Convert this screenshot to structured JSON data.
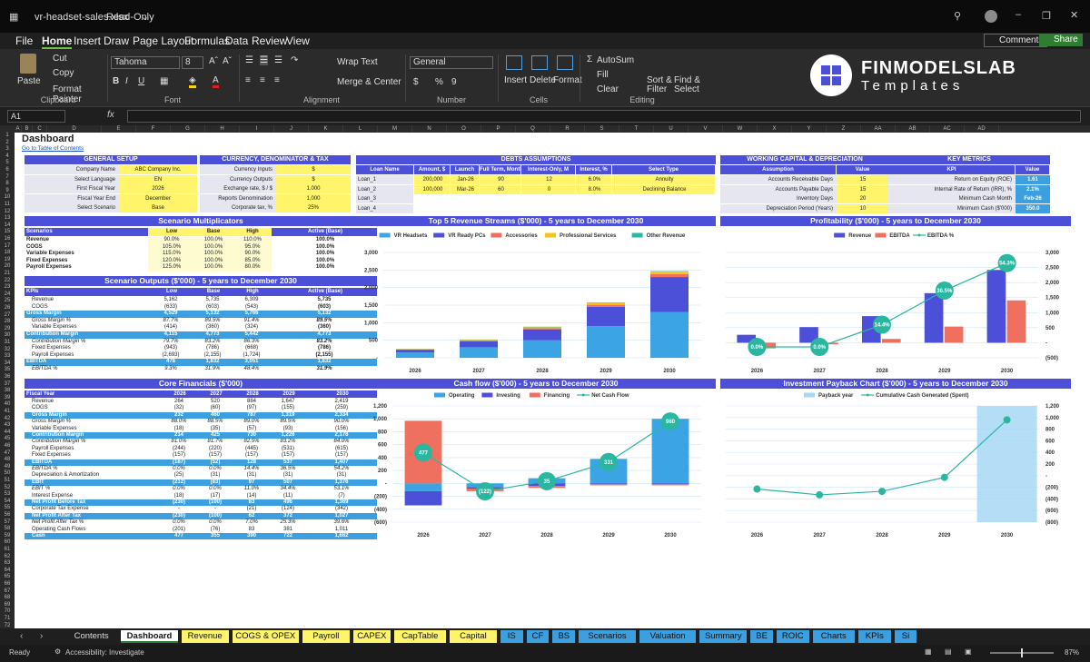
{
  "app": {
    "file": "vr-headset-sales.xlsx",
    "mode": "Read-Only"
  },
  "menu": [
    "File",
    "Home",
    "Insert",
    "Draw",
    "Page Layout",
    "Formulas",
    "Data",
    "Review",
    "View"
  ],
  "actions": {
    "comments": "Comments",
    "share": "Share"
  },
  "ribbon": {
    "paste": "Paste",
    "cut": "Cut",
    "copy": "Copy",
    "format_painter": "Format Painter",
    "clipboard": "Clipboard",
    "font_name": "Tahoma",
    "font_size": "8",
    "font": "Font",
    "wrap": "Wrap Text",
    "merge": "Merge & Center",
    "alignment": "Alignment",
    "numfmt": "General",
    "number": "Number",
    "insert": "Insert",
    "delete": "Delete",
    "format": "Format",
    "cells": "Cells",
    "autosum": "AutoSum",
    "fill": "Fill",
    "clear": "Clear",
    "sort": "Sort &",
    "filter": "Filter",
    "find": "Find &",
    "select": "Select",
    "editing": "Editing"
  },
  "logo": {
    "line1": "FINMODELSLAB",
    "line2": "Templates"
  },
  "namebox": "A1",
  "sheet": {
    "title": "Dashboard",
    "link": "Go to Table of Contents"
  },
  "columns": [
    "A",
    "B",
    "C",
    "D",
    "E",
    "F",
    "G",
    "H",
    "I",
    "J",
    "K",
    "L",
    "M",
    "N",
    "O",
    "P",
    "Q",
    "R",
    "S",
    "T",
    "U",
    "V",
    "W",
    "X",
    "Y",
    "Z",
    "AA",
    "AB",
    "AC",
    "AD"
  ],
  "general": {
    "title": "GENERAL SETUP",
    "rows": [
      [
        "Company Name",
        "ABC Company Inc."
      ],
      [
        "Select Language",
        "EN"
      ],
      [
        "First Fiscal Year",
        "2026"
      ],
      [
        "Fiscal Year End",
        "December"
      ],
      [
        "Select Scenario",
        "Base"
      ]
    ]
  },
  "currency": {
    "title": "CURRENCY, DENOMINATOR & TAX",
    "rows": [
      [
        "Currency Inputs",
        "$"
      ],
      [
        "Currency Outputs",
        "$"
      ],
      [
        "Exchange rate, $ / $",
        "1.000"
      ],
      [
        "Reports Denomination",
        "1,000"
      ],
      [
        "Corporate tax, %",
        "25%"
      ]
    ]
  },
  "debts": {
    "title": "DEBTS ASSUMPTIONS",
    "head": [
      "Loan Name",
      "Amount, $",
      "Launch",
      "Full Term, Months",
      "Interest-Only, M",
      "Interest, %",
      "Select Type"
    ],
    "rows": [
      [
        "Loan_1",
        "200,000",
        "Jan-26",
        "90",
        "12",
        "6.0%",
        "Annuity"
      ],
      [
        "Loan_2",
        "100,000",
        "Mar-26",
        "60",
        "0",
        "8.0%",
        "Declining Balance"
      ],
      [
        "Loan_3",
        "",
        "",
        "",
        "",
        "",
        ""
      ],
      [
        "Loan_4",
        "",
        "",
        "",
        "",
        "",
        ""
      ]
    ]
  },
  "wc": {
    "title": "WORKING CAPITAL & DEPRECIATION",
    "head": [
      "Assumption",
      "Value"
    ],
    "rows": [
      [
        "Accounts Receivable Days",
        "15"
      ],
      [
        "Accounts Payable Days",
        "15"
      ],
      [
        "Inventory Days",
        "20"
      ],
      [
        "Depreciation Period (Years)",
        "10"
      ]
    ]
  },
  "kpi": {
    "title": "KEY METRICS",
    "head": [
      "KPI",
      "Value"
    ],
    "rows": [
      [
        "Return on Equity (ROE)",
        "1.61"
      ],
      [
        "Internal Rate of Return (IRR), %",
        "2.1%"
      ],
      [
        "Minimum Cash Month",
        "Feb-26"
      ],
      [
        "Minimum Cash ($'000)",
        "350.0"
      ]
    ]
  },
  "mult": {
    "title": "Scenario Multiplicators",
    "head": [
      "Scenarios",
      "Low",
      "Base",
      "High",
      "Active (Base)"
    ],
    "rows": [
      [
        "Revenue",
        "90.0%",
        "100.0%",
        "110.0%",
        "100.0%"
      ],
      [
        "COGS",
        "105.0%",
        "100.0%",
        "95.0%",
        "100.0%"
      ],
      [
        "Variable Expenses",
        "115.0%",
        "100.0%",
        "90.0%",
        "100.0%"
      ],
      [
        "Fixed Expenses",
        "120.0%",
        "100.0%",
        "85.0%",
        "100.0%"
      ],
      [
        "Payroll Expenses",
        "125.0%",
        "100.0%",
        "80.0%",
        "100.0%"
      ]
    ]
  },
  "outputs": {
    "title": "Scenario Outputs ($'000) - 5 years to December 2030",
    "head": [
      "KPIs",
      "Low",
      "Base",
      "High",
      "Active (Base)"
    ],
    "rows": [
      [
        "Revenue",
        "5,162",
        "5,735",
        "6,309",
        "5,735"
      ],
      [
        "COGS",
        "(633)",
        "(603)",
        "(543)",
        "(603)"
      ],
      [
        "Gross Margin",
        "4,529",
        "5,132",
        "5,766",
        "5,132"
      ],
      [
        "Gross Margin %",
        "87.7%",
        "89.5%",
        "91.4%",
        "89.5%"
      ],
      [
        "Variable Expenses",
        "(414)",
        "(360)",
        "(324)",
        "(360)"
      ],
      [
        "Contribution Margin",
        "4,115",
        "4,773",
        "5,442",
        "4,773"
      ],
      [
        "Contribution Margin %",
        "79.7%",
        "83.2%",
        "86.3%",
        "83.2%"
      ],
      [
        "Fixed Expenses",
        "(943)",
        "(786)",
        "(668)",
        "(786)"
      ],
      [
        "Payroll Expenses",
        "(2,693)",
        "(2,155)",
        "(1,724)",
        "(2,155)"
      ],
      [
        "EBITDA",
        "478",
        "1,832",
        "3,051",
        "1,832"
      ],
      [
        "EBITDA %",
        "9.3%",
        "31.9%",
        "48.4%",
        "31.9%"
      ]
    ]
  },
  "core": {
    "title": "Core Financials ($'000)",
    "head": [
      "Fiscal Year",
      "2026",
      "2027",
      "2028",
      "2029",
      "2030"
    ],
    "rows": [
      [
        "Revenue",
        "264",
        "520",
        "884",
        "1,647",
        "2,419"
      ],
      [
        "COGS",
        "(32)",
        "(60)",
        "(97)",
        "(155)",
        "(259)"
      ],
      [
        "Gross Margin",
        "232",
        "460",
        "787",
        "1,319",
        "2,334"
      ],
      [
        "Gross Margin %",
        "88.0%",
        "88.5%",
        "89.0%",
        "89.5%",
        "90.0%"
      ],
      [
        "Variable Expenses",
        "(18)",
        "(35)",
        "(57)",
        "(93)",
        "(156)"
      ],
      [
        "Contribution Margin",
        "214",
        "425",
        "730",
        "1,226",
        "2,178"
      ],
      [
        "Contribution Margin %",
        "81.0%",
        "81.7%",
        "82.5%",
        "83.2%",
        "84.0%"
      ],
      [
        "Payroll Expenses",
        "(244)",
        "(220)",
        "(445)",
        "(531)",
        "(615)"
      ],
      [
        "Fixed Expenses",
        "(157)",
        "(157)",
        "(157)",
        "(157)",
        "(157)"
      ],
      [
        "EBITDA",
        "(187)",
        "(52)",
        "128",
        "537",
        "1,407"
      ],
      [
        "EBITDA %",
        "0.0%",
        "0.0%",
        "14.4%",
        "36.5%",
        "54.2%"
      ],
      [
        "Depreciation & Amortization",
        "(25)",
        "(31)",
        "(31)",
        "(31)",
        "(31)"
      ],
      [
        "EBIT",
        "(212)",
        "(83)",
        "97",
        "507",
        "1,376"
      ],
      [
        "EBIT %",
        "0.0%",
        "0.0%",
        "11.0%",
        "34.4%",
        "53.1%"
      ],
      [
        "Interest Expense",
        "(18)",
        "(17)",
        "(14)",
        "(11)",
        "(7)"
      ],
      [
        "Net Profit Before Tax",
        "(230)",
        "(100)",
        "83",
        "496",
        "1,369"
      ],
      [
        "Corporate Tax Expense",
        "-",
        "-",
        "(21)",
        "(124)",
        "(342)"
      ],
      [
        "Net Profit After Tax",
        "(230)",
        "(100)",
        "62",
        "372",
        "1,027"
      ],
      [
        "Net Profit After Tax %",
        "0.0%",
        "0.0%",
        "7.0%",
        "25.3%",
        "39.6%"
      ],
      [
        "Operating Cash Flows",
        "(201)",
        "(76)",
        "83",
        "381",
        "1,011"
      ],
      [
        "Cash",
        "477",
        "355",
        "390",
        "722",
        "1,682"
      ]
    ]
  },
  "chart_data": [
    {
      "type": "bar",
      "stacked": true,
      "title": "Top 5 Revenue Streams ($'000) - 5 years to December 2030",
      "categories": [
        "2026",
        "2027",
        "2028",
        "2029",
        "2030"
      ],
      "ylim": [
        0,
        3000
      ],
      "yticks": [
        "-",
        "500",
        "1,000",
        "1,500",
        "2,000",
        "2,500",
        "3,000"
      ],
      "legend": "top",
      "series": [
        {
          "name": "VR Headsets",
          "color": "#3ba4e4",
          "values": [
            150,
            300,
            500,
            900,
            1300
          ]
        },
        {
          "name": "VR Ready PCs",
          "color": "#4c4fd8",
          "values": [
            80,
            170,
            310,
            550,
            1000
          ]
        },
        {
          "name": "Accessories",
          "color": "#f07060",
          "values": [
            10,
            20,
            35,
            60,
            80
          ]
        },
        {
          "name": "Professional Services",
          "color": "#f5c518",
          "values": [
            10,
            20,
            25,
            55,
            80
          ]
        },
        {
          "name": "Other Revenue",
          "color": "#2bb6a0",
          "values": [
            5,
            10,
            14,
            10,
            10
          ]
        }
      ]
    },
    {
      "type": "bar+line",
      "title": "Profitability ($'000) - 5 years to December 2030",
      "categories": [
        "2026",
        "2027",
        "2028",
        "2029",
        "2030"
      ],
      "ylim": [
        -500,
        3000
      ],
      "yticks": [
        "(500)",
        "-",
        "500",
        "1,000",
        "1,500",
        "2,000",
        "2,500",
        "3,000"
      ],
      "legend": "top",
      "series": [
        {
          "name": "Revenue",
          "color": "#4c4fd8",
          "values": [
            264,
            520,
            884,
            1647,
            2419
          ]
        },
        {
          "name": "EBITDA",
          "color": "#f07060",
          "values": [
            -187,
            -52,
            128,
            537,
            1407
          ]
        },
        {
          "name": "EBITDA %",
          "color": "#2bb6a0",
          "values": [
            0.0,
            0.0,
            14.4,
            36.5,
            54.3
          ],
          "labels": [
            "0.0%",
            "0.0%",
            "14.4%",
            "36.5%",
            "54.3%"
          ]
        }
      ]
    },
    {
      "type": "bar+line",
      "stacked": true,
      "title": "Cash flow ($'000) - 5 years to December 2030",
      "categories": [
        "2026",
        "2027",
        "2028",
        "2029",
        "2030"
      ],
      "ylim": [
        -600,
        1200
      ],
      "yticks": [
        "(600)",
        "(400)",
        "(200)",
        "-",
        "200",
        "400",
        "600",
        "800",
        "1,000",
        "1,200"
      ],
      "legend": "top",
      "series": [
        {
          "name": "Operating",
          "color": "#3ba4e4",
          "values": [
            -120,
            -60,
            80,
            380,
            1000
          ]
        },
        {
          "name": "Investing",
          "color": "#4c4fd8",
          "values": [
            -220,
            -20,
            -40,
            -10,
            -10
          ]
        },
        {
          "name": "Financing",
          "color": "#f07060",
          "values": [
            970,
            -40,
            -30,
            -20,
            -20
          ]
        },
        {
          "name": "Net Cash Flow",
          "color": "#2bb6a0",
          "values": [
            477,
            -122,
            35,
            331,
            960
          ],
          "labels": [
            "477",
            "(122)",
            "35",
            "331",
            "960"
          ]
        }
      ]
    },
    {
      "type": "area+line",
      "title": "Investment Payback Chart ($'000) - 5 years to December 2030",
      "categories": [
        "2026",
        "2027",
        "2028",
        "2029",
        "2030"
      ],
      "ylim": [
        -800,
        1200
      ],
      "yticks": [
        "(800)",
        "(600)",
        "(400)",
        "(200)",
        "-",
        "200",
        "400",
        "600",
        "800",
        "1,000",
        "1,200"
      ],
      "legend": "top",
      "series": [
        {
          "name": "Payback year",
          "color": "#a6d8f5",
          "values": [
            0,
            0,
            0,
            0,
            1200
          ]
        },
        {
          "name": "Cumulative Cash Generated (Spent)",
          "color": "#2bb6a0",
          "values": [
            -230,
            -330,
            -270,
            -30,
            960
          ]
        }
      ]
    }
  ],
  "tabs": [
    {
      "n": "Contents",
      "c": "#1f1f1f",
      "t": "#ddd"
    },
    {
      "n": "Dashboard",
      "c": "#ffffff",
      "t": "#111",
      "active": true
    },
    {
      "n": "Revenue",
      "c": "#fff46a"
    },
    {
      "n": "COGS & OPEX",
      "c": "#fff46a"
    },
    {
      "n": "Payroll",
      "c": "#fff46a"
    },
    {
      "n": "CAPEX",
      "c": "#fff46a"
    },
    {
      "n": "CapTable",
      "c": "#fff46a"
    },
    {
      "n": "Capital",
      "c": "#fff46a"
    },
    {
      "n": "IS",
      "c": "#3b9fe0"
    },
    {
      "n": "CF",
      "c": "#3b9fe0"
    },
    {
      "n": "BS",
      "c": "#3b9fe0"
    },
    {
      "n": "Scenarios",
      "c": "#3b9fe0"
    },
    {
      "n": "Valuation",
      "c": "#3b9fe0"
    },
    {
      "n": "Summary",
      "c": "#3b9fe0"
    },
    {
      "n": "BE",
      "c": "#3b9fe0"
    },
    {
      "n": "ROIC",
      "c": "#3b9fe0"
    },
    {
      "n": "Charts",
      "c": "#3b9fe0"
    },
    {
      "n": "KPIs",
      "c": "#3b9fe0"
    },
    {
      "n": "Si",
      "c": "#3b9fe0"
    }
  ],
  "status": {
    "ready": "Ready",
    "access": "Accessibility: Investigate",
    "zoom": "87%"
  }
}
